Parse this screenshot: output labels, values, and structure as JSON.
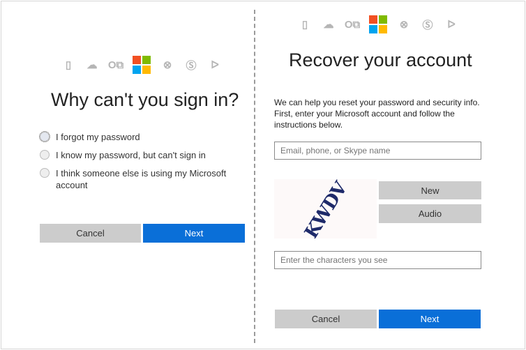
{
  "left": {
    "title": "Why can't you sign in?",
    "options": [
      {
        "label": "I forgot my password"
      },
      {
        "label": "I know my password, but can't sign in"
      },
      {
        "label": "I think someone else is using my Microsoft account"
      }
    ],
    "cancel_label": "Cancel",
    "next_label": "Next"
  },
  "right": {
    "title": "Recover your account",
    "description": "We can help you reset your password and security info. First, enter your Microsoft account and follow the instructions below.",
    "account_input": {
      "value": "",
      "placeholder": "Email, phone, or Skype name"
    },
    "captcha_text": "KWDV",
    "new_label": "New",
    "audio_label": "Audio",
    "captcha_input": {
      "value": "",
      "placeholder": "Enter the characters you see"
    },
    "cancel_label": "Cancel",
    "next_label": "Next"
  },
  "icons": [
    "office-icon",
    "onedrive-icon",
    "outlook-icon",
    "microsoft-logo",
    "xbox-icon",
    "skype-icon",
    "bing-icon"
  ],
  "colors": {
    "accent": "#0a6fd8",
    "button_gray": "#cccccc",
    "ms_red": "#f25022",
    "ms_green": "#7fba00",
    "ms_blue": "#00a4ef",
    "ms_yellow": "#ffb900"
  }
}
